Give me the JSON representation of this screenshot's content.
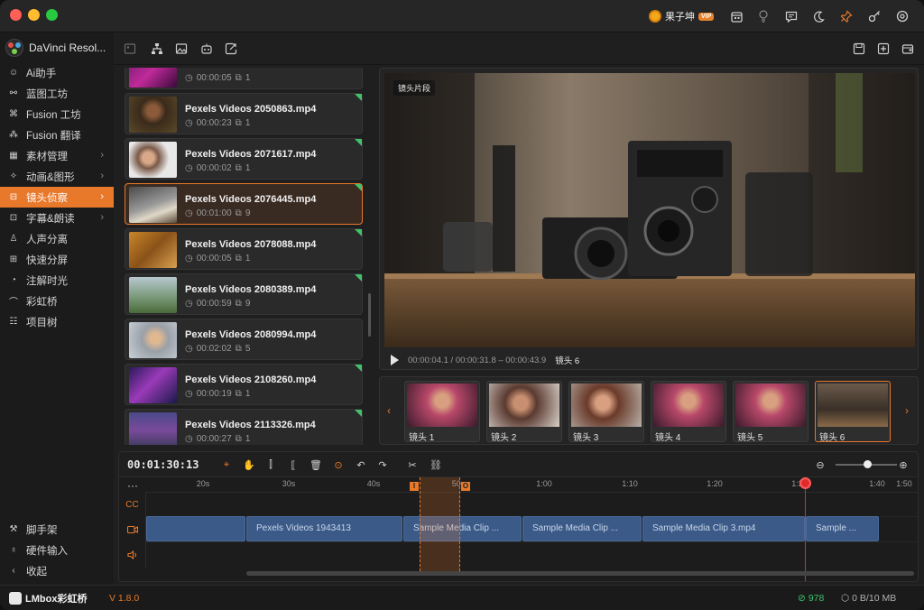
{
  "titlebar": {
    "username": "果子坤",
    "vip_badge": "VIP",
    "icons": [
      "calendar-icon",
      "lightbulb-icon",
      "chat-icon",
      "moon-icon",
      "pin-icon",
      "key-icon",
      "settings-icon"
    ]
  },
  "sidebar": {
    "app_name": "DaVinci Resol...",
    "items": [
      {
        "label": "Ai助手",
        "icon": "smile-icon"
      },
      {
        "label": "蓝图工坊",
        "icon": "blueprint-icon"
      },
      {
        "label": "Fusion 工坊",
        "icon": "nodes-icon"
      },
      {
        "label": "Fusion 翻译",
        "icon": "translate-icon"
      },
      {
        "label": "素材管理",
        "icon": "grid-icon"
      },
      {
        "label": "动画&图形",
        "icon": "sparkle-icon"
      },
      {
        "label": "镜头侦察",
        "icon": "scout-icon"
      },
      {
        "label": "字幕&朗读",
        "icon": "subtitle-icon"
      },
      {
        "label": "人声分离",
        "icon": "person-icon"
      },
      {
        "label": "快速分屏",
        "icon": "split-grid-icon"
      },
      {
        "label": "注解时光",
        "icon": "comment-icon"
      },
      {
        "label": "彩虹桥",
        "icon": "rainbow-icon"
      },
      {
        "label": "项目树",
        "icon": "tree-icon"
      }
    ],
    "bottom_items": [
      {
        "label": "脚手架",
        "icon": "scaffold-icon"
      },
      {
        "label": "硬件输入",
        "icon": "joystick-icon"
      },
      {
        "label": "收起",
        "icon": "collapse-icon"
      }
    ]
  },
  "clips": [
    {
      "name": "",
      "duration": "00:00:05",
      "shots": "1"
    },
    {
      "name": "Pexels Videos 2050863.mp4",
      "duration": "00:00:23",
      "shots": "1"
    },
    {
      "name": "Pexels Videos 2071617.mp4",
      "duration": "00:00:02",
      "shots": "1"
    },
    {
      "name": "Pexels Videos 2076445.mp4",
      "duration": "00:01:00",
      "shots": "9"
    },
    {
      "name": "Pexels Videos 2078088.mp4",
      "duration": "00:00:05",
      "shots": "1"
    },
    {
      "name": "Pexels Videos 2080389.mp4",
      "duration": "00:00:59",
      "shots": "9"
    },
    {
      "name": "Pexels Videos 2080994.mp4",
      "duration": "00:02:02",
      "shots": "5"
    },
    {
      "name": "Pexels Videos 2108260.mp4",
      "duration": "00:00:19",
      "shots": "1"
    },
    {
      "name": "Pexels Videos 2113326.mp4",
      "duration": "00:00:27",
      "shots": "1"
    }
  ],
  "viewer": {
    "tag": "镜头片段",
    "timecode": "00:00:04.1 / 00:00:31.8 – 00:00:43.9",
    "shot_label": "镜头 6"
  },
  "shots": [
    "镜头 1",
    "镜头 2",
    "镜头 3",
    "镜头 4",
    "镜头 5",
    "镜头 6"
  ],
  "timeline": {
    "timecode": "00:01:30:13",
    "ruler": [
      "20s",
      "30s",
      "40s",
      "50s",
      "1:00",
      "1:10",
      "1:20",
      "1:30",
      "1:40",
      "1:50"
    ],
    "in_mark": "I",
    "out_mark": "O",
    "playhead_mark": "B",
    "tracks": [
      "CC",
      "video-track",
      "audio-track"
    ],
    "clips": [
      {
        "label": ""
      },
      {
        "label": "Pexels Videos 1943413"
      },
      {
        "label": "Sample Media Clip ..."
      },
      {
        "label": "Sample Media Clip ..."
      },
      {
        "label": "Sample Media Clip 3.mp4"
      },
      {
        "label": "Sample ..."
      }
    ]
  },
  "status": {
    "brand": "LMbox彩虹桥",
    "version": "V 1.8.0",
    "online_count": "978",
    "storage": "0 B/10 MB"
  },
  "colors": {
    "accent": "#e8782a",
    "clip_blue": "#3b5a88",
    "online_green": "#3bc36a",
    "playhead_red": "#e02b2b"
  }
}
